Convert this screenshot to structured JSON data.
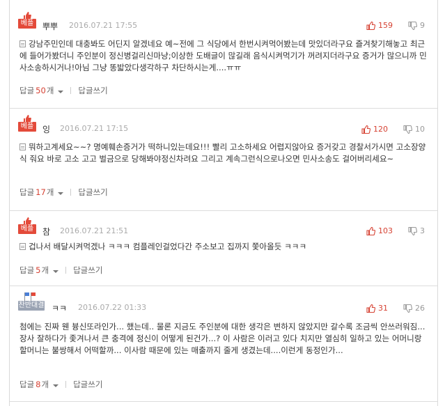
{
  "comments": [
    {
      "badge": "베플",
      "author": "뿌뿌",
      "date": "2016.07.21 17:55",
      "up": "159",
      "down": "9",
      "text": "강남주민인데 대충봐도 어딘지 알겠네요 예~전에 그 식당에서 한번시켜먹어봤는데 맛있더라구요 즐겨찾기해놓고 최근에 들어가봤더니 주인분이 정신병걸리신마냥;이상한 도배글이 많길래 음식시켜먹기가 꺼려지더라구요 증거가 많으니까 민사소송하시거나!아님 그냥 똥밟았다생각하구 차단하시는게....ㅠㅠ",
      "reply_label": "답글",
      "reply_count": "50",
      "reply_unit": "개",
      "write_label": "답글쓰기"
    },
    {
      "badge": "베플",
      "author": "잉",
      "date": "2016.07.21 17:15",
      "up": "120",
      "down": "10",
      "text": "뭐하고계세요~~? 명예훼손증거가 떡하니있는데요!!! 빨리 고소하세요 어렵지않아요 증거갖고 경찰서가시면 고소장양식 줘요 바로 고소 고고 벌금으로 당해봐야정신차려요 그리고 계속그런식으로나오면 민사소송도 걸어버리세요~",
      "reply_label": "답글",
      "reply_count": "17",
      "reply_unit": "개",
      "write_label": "답글쓰기"
    },
    {
      "badge": "베플",
      "author": "참",
      "date": "2016.07.21 21:51",
      "up": "103",
      "down": "3",
      "text": "겁나서 배달시켜먹겠나 ㅋㅋㅋ 컴플레인걸었다간 주소보고 집까지 쫓아올듯 ㅋㅋㅋ",
      "reply_label": "답글",
      "reply_count": "5",
      "reply_unit": "개",
      "write_label": "답글쓰기"
    },
    {
      "badge": "찬반대결",
      "author": "ㅋㅋ",
      "date": "2016.07.22 01:33",
      "up": "31",
      "down": "26",
      "text": "첨에는 진짜 웬 븅신또라인가... 했는데.. 물론 지금도 주인분에 대한 생각은 변하지 않았지만 갈수록 조금씩 안쓰러워짐... 장사 잘하다가 좇겨나서 큰 충격에 정신이 어떻게 된건가...? 이 사람은 이러고 있다 치지만 열심히 일하고 있는 어머니랑 할머니는 불쌍해서 어떡할까... 이사람 때문에 있는 매출까지 줄게 생겼는데....이런게 동정인가...",
      "reply_label": "답글",
      "reply_count": "8",
      "reply_unit": "개",
      "write_label": "답글쓰기"
    }
  ],
  "colors": {
    "accent": "#e34a3a",
    "vote_up": "#d64233",
    "neutral_badge": "#9aa3b3"
  },
  "icons": {
    "thumb": "thumbs-up-icon",
    "flag": "flag-icon",
    "down": "thumbs-down-icon",
    "doc": "document-icon"
  }
}
